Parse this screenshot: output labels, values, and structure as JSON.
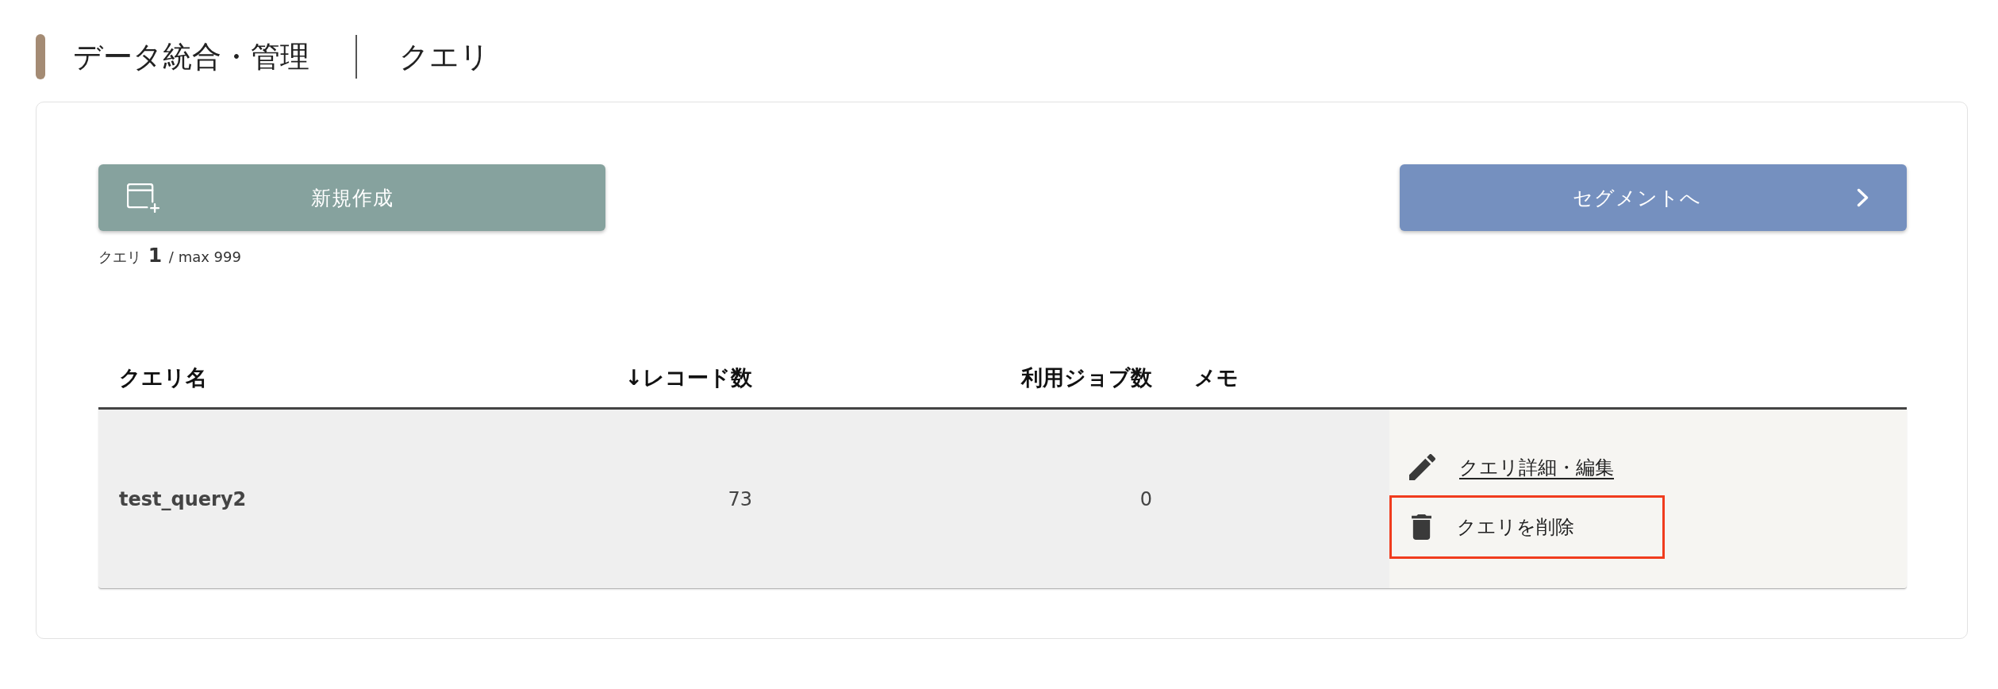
{
  "breadcrumb": {
    "section": "データ統合・管理",
    "page": "クエリ"
  },
  "toolbar": {
    "create_button": {
      "label": "新規作成"
    },
    "count_text": "クエリ **1** / max 999",
    "segment_button": {
      "label": "セグメントへ"
    }
  },
  "table": {
    "columns": [
      {
        "label": "クエリ名"
      },
      {
        "label": "↓レコード数"
      },
      {
        "label": "利用ジョブ数"
      },
      {
        "label": "メモ"
      }
    ],
    "rows": [
      {
        "cells": [
          "test_query2",
          "73",
          "0"
        ],
        "actions": [
          {
            "kind": "edit",
            "label": "クエリ詳細・編集",
            "highlighted": false
          },
          {
            "kind": "delete",
            "label": "クエリを削除",
            "highlighted": true
          }
        ]
      }
    ]
  }
}
